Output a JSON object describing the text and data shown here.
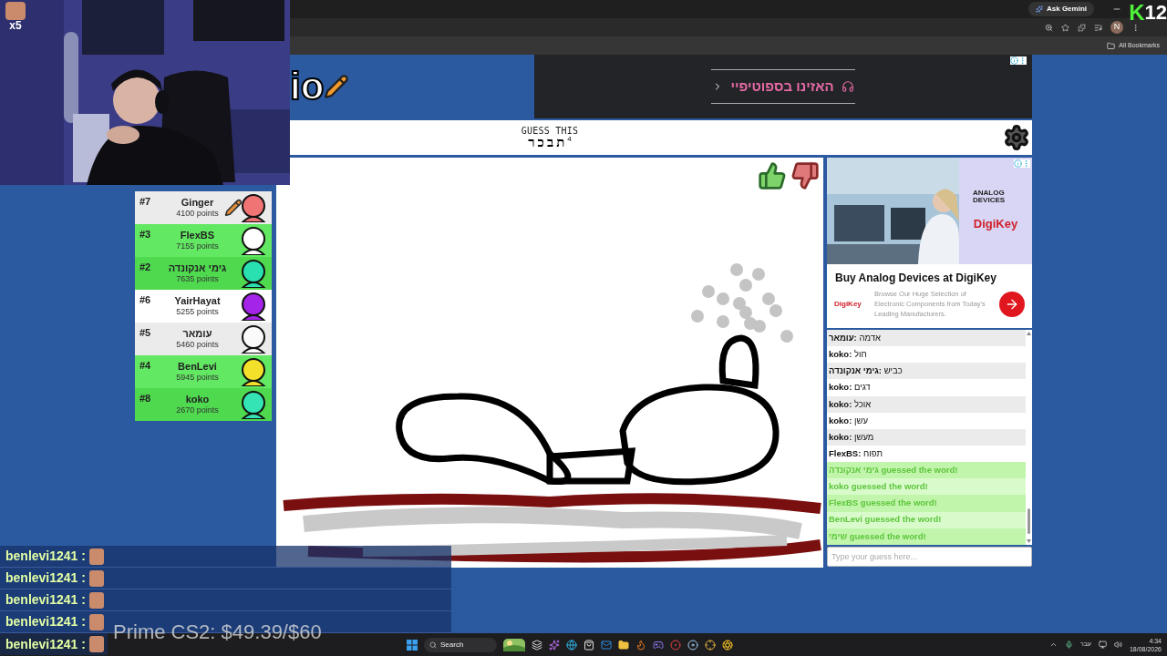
{
  "stream_overlay": {
    "emote_count": "x5",
    "brand_mark": "K",
    "brand_digits": "12",
    "goal_text": "Prime CS2: $49.39/$60",
    "chat": [
      {
        "user": "benlevi1241 :"
      },
      {
        "user": "benlevi1241 :"
      },
      {
        "user": "benlevi1241 :"
      },
      {
        "user": "benlevi1241 :"
      },
      {
        "user": "benlevi1241 :"
      }
    ]
  },
  "browser": {
    "gemini_button": "Ask Gemini",
    "profile_initial": "N",
    "bookmarks_label": "All Bookmarks"
  },
  "game": {
    "logo_text": "io",
    "top_ad": {
      "text": "האזינו בספוטיפיי"
    },
    "header": {
      "label": "GUESS THIS",
      "word": "תבכר",
      "letter_count": "4"
    },
    "players": [
      {
        "rank": "#7",
        "name": "Ginger",
        "points": "4100 points",
        "guessed": false,
        "drawing": true,
        "color": "#f07474"
      },
      {
        "rank": "#3",
        "name": "FlexBS",
        "points": "7155 points",
        "guessed": true,
        "drawing": false,
        "color": "#ffffff"
      },
      {
        "rank": "#2",
        "name": "גימי אנקונדה",
        "points": "7635 points",
        "guessed": true,
        "drawing": false,
        "color": "#28e0b0"
      },
      {
        "rank": "#6",
        "name": "YairHayat",
        "points": "5255 points",
        "guessed": false,
        "drawing": false,
        "color": "#a424e8"
      },
      {
        "rank": "#5",
        "name": "עומאר",
        "points": "5460 points",
        "guessed": false,
        "drawing": false,
        "color": "#fafafa"
      },
      {
        "rank": "#4",
        "name": "BenLevi",
        "points": "5945 points",
        "guessed": true,
        "drawing": false,
        "color": "#f2e02a"
      },
      {
        "rank": "#8",
        "name": "koko",
        "points": "2670 points",
        "guessed": true,
        "drawing": false,
        "color": "#34e4b4"
      }
    ],
    "side_ad": {
      "brand_top": "ANALOG DEVICES",
      "brand_bottom": "DigiKey",
      "title": "Buy Analog Devices at DigiKey",
      "small_logo": "DigiKey",
      "description": "Browse Our Huge Selection of Electronic Components from Today's Leading Manufacturers."
    },
    "chat": {
      "messages": [
        {
          "kind": "message",
          "author": "עומאר:",
          "text": "אדמה"
        },
        {
          "kind": "message",
          "author": "koko:",
          "text": "חול"
        },
        {
          "kind": "message",
          "author": "גימי אנקונדה:",
          "text": "כביש"
        },
        {
          "kind": "message",
          "author": "koko:",
          "text": "דגים"
        },
        {
          "kind": "message",
          "author": "koko:",
          "text": "אוכל"
        },
        {
          "kind": "message",
          "author": "koko:",
          "text": "עשן"
        },
        {
          "kind": "message",
          "author": "koko:",
          "text": "מעשן"
        },
        {
          "kind": "message",
          "author": "FlexBS:",
          "text": "תפוח"
        },
        {
          "kind": "guessed",
          "text": "גימי אנקונדה guessed the word!"
        },
        {
          "kind": "guessed",
          "text": "koko guessed the word!"
        },
        {
          "kind": "guessed",
          "text": "FlexBS guessed the word!"
        },
        {
          "kind": "guessed",
          "text": "BenLevi guessed the word!"
        },
        {
          "kind": "guessed",
          "text": "שימי guessed the word!"
        }
      ],
      "placeholder": "Type your guess here..."
    }
  },
  "taskbar": {
    "search_placeholder": "Search",
    "language": "עבר",
    "time": "4:34",
    "date": "18/08/2026"
  }
}
